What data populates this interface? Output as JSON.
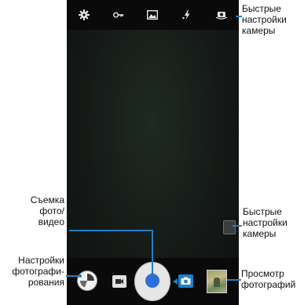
{
  "top_toolbar": {
    "icons": [
      "gear-icon",
      "key-icon",
      "image-icon",
      "flash-icon",
      "camera-switch-icon"
    ]
  },
  "bottom_toolbar": {
    "icons": [
      "settings-dial-icon",
      "video-camera-icon",
      "shutter-button",
      "photo-camera-icon",
      "gallery-thumbnail"
    ]
  },
  "annotations": {
    "quick_settings_top": "Быстрые\nнастройки\nкамеры",
    "quick_settings_side": "Быстрые\nнастройки\nкамеры",
    "capture": "Съемка\nфото/\nвидео",
    "shooting_settings": "Настройки\nфотографи-\nрования",
    "view_photos": "Просмотр\nфотографий"
  },
  "colors": {
    "accent": "#1e7fc8",
    "shutter": "#2f6fd8",
    "toolbar_bg": "#0a0a0a"
  }
}
